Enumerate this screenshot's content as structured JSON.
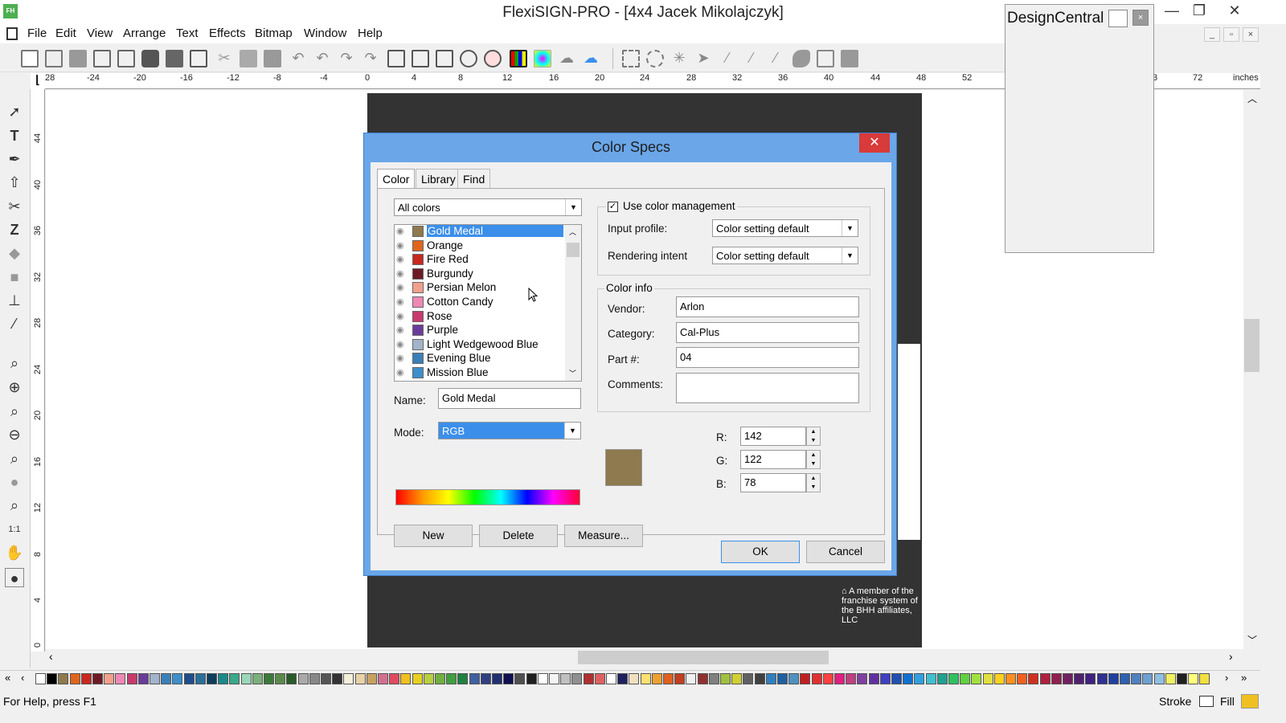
{
  "window": {
    "title": "FlexiSIGN-PRO - [4x4 Jacek Mikolajczyk]",
    "icon_label": "FH",
    "controls": {
      "minimize": "—",
      "maximize": "❐",
      "close": "✕"
    }
  },
  "menu": [
    "File",
    "Edit",
    "View",
    "Arrange",
    "Text",
    "Effects",
    "Bitmap",
    "Window",
    "Help"
  ],
  "mdi_controls": {
    "minimize": "_",
    "restore": "▫",
    "close": "×"
  },
  "ruler": {
    "h_labels": [
      "28",
      "-24",
      "-20",
      "-16",
      "-12",
      "-8",
      "-4",
      "0",
      "4",
      "8",
      "12",
      "16",
      "20",
      "24",
      "28",
      "32",
      "36",
      "40",
      "44",
      "48",
      "52",
      "3",
      "72"
    ],
    "unit": "inches",
    "v_labels": [
      "44",
      "40",
      "36",
      "32",
      "28",
      "24",
      "20",
      "16",
      "12",
      "8",
      "4",
      "0"
    ]
  },
  "canvas": {
    "footer_text": "A member of the franchise system of the BHH affiliates, LLC",
    "artboard_color": "#333333"
  },
  "design_central": {
    "title": "DesignCentral",
    "close": "×"
  },
  "dialog": {
    "title": "Color Specs",
    "close": "✕",
    "tabs": [
      "Color",
      "Library",
      "Find"
    ],
    "active_tab": "Color",
    "filter": "All colors",
    "colors": [
      {
        "name": "Gold Medal",
        "hex": "#8E7A4E",
        "selected": true
      },
      {
        "name": "Orange",
        "hex": "#E0651C"
      },
      {
        "name": "Fire Red",
        "hex": "#C8281E"
      },
      {
        "name": "Burgundy",
        "hex": "#6E1A24"
      },
      {
        "name": "Persian Melon",
        "hex": "#F2A08C"
      },
      {
        "name": "Cotton Candy",
        "hex": "#EE88B4"
      },
      {
        "name": "Rose",
        "hex": "#C83A6E"
      },
      {
        "name": "Purple",
        "hex": "#6A3C9A"
      },
      {
        "name": "Light Wedgewood Blue",
        "hex": "#A3B4CA"
      },
      {
        "name": "Evening Blue",
        "hex": "#3B7FB8"
      },
      {
        "name": "Mission Blue",
        "hex": "#3C8FCB"
      }
    ],
    "name_label": "Name:",
    "name_value": "Gold Medal",
    "mode_label": "Mode:",
    "mode_value": "RGB",
    "buttons": {
      "new": "New",
      "delete": "Delete",
      "measure": "Measure...",
      "ok": "OK",
      "cancel": "Cancel"
    },
    "color_management": {
      "checkbox_label": "Use color management",
      "checked": true,
      "input_profile_label": "Input profile:",
      "input_profile_value": "Color setting default",
      "rendering_intent_label": "Rendering intent",
      "rendering_intent_value": "Color setting default"
    },
    "color_info": {
      "group_label": "Color info",
      "vendor_label": "Vendor:",
      "vendor_value": "Arlon",
      "category_label": "Category:",
      "category_value": "Cal-Plus",
      "part_label": "Part #:",
      "part_value": "04",
      "comments_label": "Comments:",
      "comments_value": ""
    },
    "rgb": {
      "r_label": "R:",
      "r_value": "142",
      "g_label": "G:",
      "g_value": "122",
      "b_label": "B:",
      "b_value": "78"
    },
    "preview_color": "#8E7A4E"
  },
  "palette": [
    "#ffffff",
    "#000000",
    "#8E7A4E",
    "#E0651C",
    "#C8281E",
    "#6E1A24",
    "#F2A08C",
    "#EE88B4",
    "#C83A6E",
    "#6A3C9A",
    "#A3B4CA",
    "#3B7FB8",
    "#3C8FCB",
    "#1f4e8c",
    "#2a6f9a",
    "#0f3e5c",
    "#1a8a8a",
    "#3aa88a",
    "#9ad6b8",
    "#7ab07a",
    "#3a7a3a",
    "#5a8a4a",
    "#2a5a2a",
    "#aaaaaa",
    "#888888",
    "#555555",
    "#333333",
    "#f3efd8",
    "#e7d2a8",
    "#c8a060",
    "#d27090",
    "#e04a60",
    "#f0c020",
    "#e8d020",
    "#b8d040",
    "#70b040",
    "#40a040",
    "#208040",
    "#4060a0",
    "#304080",
    "#203070",
    "#101050",
    "#505050",
    "#202020",
    "#ffffff",
    "#f4f4f4",
    "#c0c0c0",
    "#909090",
    "#b03030",
    "#e06060",
    "#ffffff",
    "#202060",
    "#f0e0c0",
    "#ffe070",
    "#f0a030",
    "#e06020",
    "#c04020",
    "#f0f0f0",
    "#903030",
    "#808080",
    "#a0c040",
    "#d0d030",
    "#606060",
    "#404040",
    "#3080c0",
    "#2060a0",
    "#5090c0",
    "#c02020",
    "#e03030",
    "#ff4040",
    "#e0208080",
    "#c04080",
    "#8040a0",
    "#6030a0",
    "#4040c0",
    "#2050b0",
    "#1070d0",
    "#30a0e0",
    "#40c0d0",
    "#20a090",
    "#30c060",
    "#60d040",
    "#a0e040",
    "#e0e040",
    "#ffd020",
    "#ff9020",
    "#f06020",
    "#d03020",
    "#b02040",
    "#902050",
    "#702060",
    "#502070",
    "#402080",
    "#303090",
    "#2040a0",
    "#3060b0",
    "#5080c0",
    "#70a0d0",
    "#90c0e0",
    "#f0f060",
    "#202020",
    "#ffff80",
    "#f0e040",
    "#ffffff",
    "#e0e060",
    "#1a1a1a",
    "#f0c040"
  ],
  "status": {
    "help": "For Help, press F1",
    "stroke_label": "Stroke",
    "fill_label": "Fill",
    "fill_color": "#f0c020"
  }
}
